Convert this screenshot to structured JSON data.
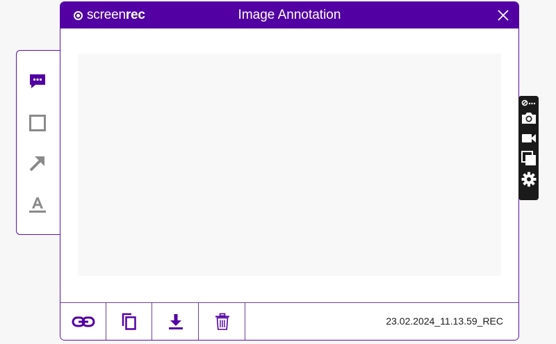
{
  "window": {
    "title": "Image Annotation",
    "logo_light": "screen",
    "logo_bold": "rec"
  },
  "left_tools": [
    {
      "name": "comment-tool",
      "icon": "comment-icon",
      "active": true
    },
    {
      "name": "rectangle-tool",
      "icon": "square-icon",
      "active": false
    },
    {
      "name": "arrow-tool",
      "icon": "arrow-icon",
      "active": false
    },
    {
      "name": "text-tool",
      "icon": "text-icon",
      "active": false
    }
  ],
  "footer": {
    "buttons": [
      "link-icon",
      "copy-icon",
      "download-icon",
      "trash-icon"
    ],
    "filename": "23.02.2024_11.13.59_REC"
  },
  "side_bar": {
    "items": [
      "link-more-icon",
      "camera-icon",
      "video-icon",
      "gallery-icon",
      "gear-icon"
    ]
  },
  "colors": {
    "brand": "#5200a3",
    "accent": "#5a0fa8",
    "inactive_tool": "#8a8a8a",
    "side_bar": "#1a1a1a"
  }
}
